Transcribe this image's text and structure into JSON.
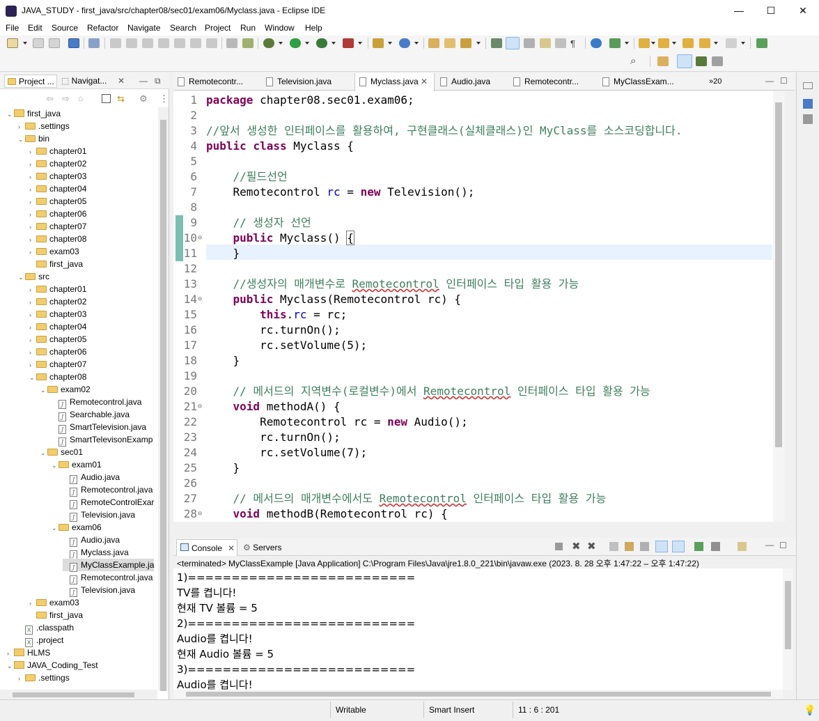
{
  "window": {
    "title": "JAVA_STUDY - first_java/src/chapter08/sec01/exam06/Myclass.java - Eclipse IDE",
    "minimize": "—",
    "maximize": "☐",
    "close": "✕"
  },
  "menu": [
    "File",
    "Edit",
    "Source",
    "Refactor",
    "Navigate",
    "Search",
    "Project",
    "Run",
    "Window",
    "Help"
  ],
  "left_panel": {
    "tab_project": "Project ...",
    "tab_navigator": "Navigat...",
    "tree": [
      {
        "label": "first_java",
        "level": 0,
        "icon": "project",
        "expanded": true
      },
      {
        "label": ".settings",
        "level": 1,
        "icon": "folder",
        "expanded": false
      },
      {
        "label": "bin",
        "level": 1,
        "icon": "folder",
        "expanded": true
      },
      {
        "label": "chapter01",
        "level": 2,
        "icon": "folder",
        "expanded": false
      },
      {
        "label": "chapter02",
        "level": 2,
        "icon": "folder",
        "expanded": false
      },
      {
        "label": "chapter03",
        "level": 2,
        "icon": "folder",
        "expanded": false
      },
      {
        "label": "chapter04",
        "level": 2,
        "icon": "folder",
        "expanded": false
      },
      {
        "label": "chapter05",
        "level": 2,
        "icon": "folder",
        "expanded": false
      },
      {
        "label": "chapter06",
        "level": 2,
        "icon": "folder",
        "expanded": false
      },
      {
        "label": "chapter07",
        "level": 2,
        "icon": "folder",
        "expanded": false
      },
      {
        "label": "chapter08",
        "level": 2,
        "icon": "folder",
        "expanded": false
      },
      {
        "label": "exam03",
        "level": 2,
        "icon": "folder",
        "expanded": false
      },
      {
        "label": "first_java",
        "level": 2,
        "icon": "folder",
        "expanded": null
      },
      {
        "label": "src",
        "level": 1,
        "icon": "folder",
        "expanded": true
      },
      {
        "label": "chapter01",
        "level": 2,
        "icon": "folder",
        "expanded": false
      },
      {
        "label": "chapter02",
        "level": 2,
        "icon": "folder",
        "expanded": false
      },
      {
        "label": "chapter03",
        "level": 2,
        "icon": "folder",
        "expanded": false
      },
      {
        "label": "chapter04",
        "level": 2,
        "icon": "folder",
        "expanded": false
      },
      {
        "label": "chapter05",
        "level": 2,
        "icon": "folder",
        "expanded": false
      },
      {
        "label": "chapter06",
        "level": 2,
        "icon": "folder",
        "expanded": false
      },
      {
        "label": "chapter07",
        "level": 2,
        "icon": "folder",
        "expanded": false
      },
      {
        "label": "chapter08",
        "level": 2,
        "icon": "folder",
        "expanded": true
      },
      {
        "label": "exam02",
        "level": 3,
        "icon": "folder",
        "expanded": true
      },
      {
        "label": "Remotecontrol.java",
        "level": 4,
        "icon": "java",
        "expanded": null
      },
      {
        "label": "Searchable.java",
        "level": 4,
        "icon": "java",
        "expanded": null
      },
      {
        "label": "SmartTelevision.java",
        "level": 4,
        "icon": "java",
        "expanded": null
      },
      {
        "label": "SmartTelevisonExamp",
        "level": 4,
        "icon": "java",
        "expanded": null
      },
      {
        "label": "sec01",
        "level": 3,
        "icon": "folder",
        "expanded": true
      },
      {
        "label": "exam01",
        "level": 4,
        "icon": "folder",
        "expanded": true
      },
      {
        "label": "Audio.java",
        "level": 5,
        "icon": "java",
        "expanded": null
      },
      {
        "label": "Remotecontrol.java",
        "level": 5,
        "icon": "java",
        "expanded": null
      },
      {
        "label": "RemoteControlExar",
        "level": 5,
        "icon": "java",
        "expanded": null
      },
      {
        "label": "Television.java",
        "level": 5,
        "icon": "java",
        "expanded": null
      },
      {
        "label": "exam06",
        "level": 4,
        "icon": "folder",
        "expanded": true
      },
      {
        "label": "Audio.java",
        "level": 5,
        "icon": "java",
        "expanded": null
      },
      {
        "label": "Myclass.java",
        "level": 5,
        "icon": "java",
        "expanded": null
      },
      {
        "label": "MyClassExample.ja",
        "level": 5,
        "icon": "java",
        "expanded": null,
        "selected": true
      },
      {
        "label": "Remotecontrol.java",
        "level": 5,
        "icon": "java",
        "expanded": null
      },
      {
        "label": "Television.java",
        "level": 5,
        "icon": "java",
        "expanded": null
      },
      {
        "label": "exam03",
        "level": 2,
        "icon": "folder",
        "expanded": false
      },
      {
        "label": "first_java",
        "level": 2,
        "icon": "folder",
        "expanded": null
      },
      {
        "label": ".classpath",
        "level": 1,
        "icon": "xml",
        "expanded": null
      },
      {
        "label": ".project",
        "level": 1,
        "icon": "xml",
        "expanded": null
      },
      {
        "label": "HLMS",
        "level": 0,
        "icon": "project",
        "expanded": false
      },
      {
        "label": "JAVA_Coding_Test",
        "level": 0,
        "icon": "project",
        "expanded": true
      },
      {
        "label": ".settings",
        "level": 1,
        "icon": "folder",
        "expanded": false
      }
    ]
  },
  "editor_tabs": [
    {
      "label": "Remotecontr...",
      "active": false
    },
    {
      "label": "Television.java",
      "active": false
    },
    {
      "label": "Myclass.java",
      "active": true
    },
    {
      "label": "Audio.java",
      "active": false
    },
    {
      "label": "Remotecontr...",
      "active": false
    },
    {
      "label": "MyClassExam...",
      "active": false
    }
  ],
  "editor_overflow": "»20",
  "code_lines": [
    {
      "n": "1",
      "html": "<span class='kw'>package</span> chapter08.sec01.exam06;"
    },
    {
      "n": "2",
      "html": ""
    },
    {
      "n": "3",
      "html": "<span class='cm'>//앞서 생성한 인터페이스를 활용하여, 구현클래스(실체클래스)인 MyClass를 소스코딩합니다.</span>"
    },
    {
      "n": "4",
      "html": "<span class='kw'>public</span> <span class='kw'>class</span> Myclass {"
    },
    {
      "n": "5",
      "html": ""
    },
    {
      "n": "6",
      "html": "    <span class='cm'>//필드선언</span>"
    },
    {
      "n": "7",
      "html": "    Remotecontrol <span class='fld'>rc</span> = <span class='kw'>new</span> Television();"
    },
    {
      "n": "8",
      "html": ""
    },
    {
      "n": "9",
      "html": "    <span class='cm'>// 생성자 선언</span>"
    },
    {
      "n": "10",
      "html": "    <span class='kw'>public</span> Myclass() <span style='outline:1px solid #777'>{</span>"
    },
    {
      "n": "11",
      "html": "    }"
    },
    {
      "n": "12",
      "html": ""
    },
    {
      "n": "13",
      "html": "    <span class='cm'>//생성자의 매개변수로 <span class='sq'>Remotecontrol</span> 인터페이스 타입 활용 가능</span>"
    },
    {
      "n": "14",
      "html": "    <span class='kw'>public</span> Myclass(Remotecontrol rc) {"
    },
    {
      "n": "15",
      "html": "        <span class='kw'>this</span>.<span class='fld'>rc</span> = rc;"
    },
    {
      "n": "16",
      "html": "        rc.turnOn();"
    },
    {
      "n": "17",
      "html": "        rc.setVolume(5);"
    },
    {
      "n": "18",
      "html": "    }"
    },
    {
      "n": "19",
      "html": ""
    },
    {
      "n": "20",
      "html": "    <span class='cm'>// 메서드의 지역변수(로컬변수)에서 <span class='sq'>Remotecontrol</span> 인터페이스 타입 활용 가능</span>"
    },
    {
      "n": "21",
      "html": "    <span class='kw'>void</span> methodA() {"
    },
    {
      "n": "22",
      "html": "        Remotecontrol rc = <span class='kw'>new</span> Audio();"
    },
    {
      "n": "23",
      "html": "        rc.turnOn();"
    },
    {
      "n": "24",
      "html": "        rc.setVolume(7);"
    },
    {
      "n": "25",
      "html": "    }"
    },
    {
      "n": "26",
      "html": ""
    },
    {
      "n": "27",
      "html": "    <span class='cm'>// 메서드의 매개변수에서도 <span class='sq'>Remotecontrol</span> 인터페이스 타입 활용 가능</span>"
    },
    {
      "n": "28",
      "html": "    <span class='kw'>void</span> methodB(Remotecontrol rc) {"
    }
  ],
  "console": {
    "tab_console": "Console",
    "tab_servers": "Servers",
    "header": "<terminated> MyClassExample [Java Application] C:\\Program Files\\Java\\jre1.8.0_221\\bin\\javaw.exe  (2023. 8. 28 오후 1:47:22 – 오후 1:47:22)",
    "lines": [
      "1)==========================",
      "TV를 켭니다!",
      "현재 TV 볼륨 = 5",
      "2)==========================",
      "Audio를 켭니다!",
      "현재 Audio 볼륨 = 5",
      "3)==========================",
      "Audio를 켭니다!"
    ]
  },
  "status": {
    "writable": "Writable",
    "insert_mode": "Smart Insert",
    "position": "11 : 6 : 201"
  }
}
